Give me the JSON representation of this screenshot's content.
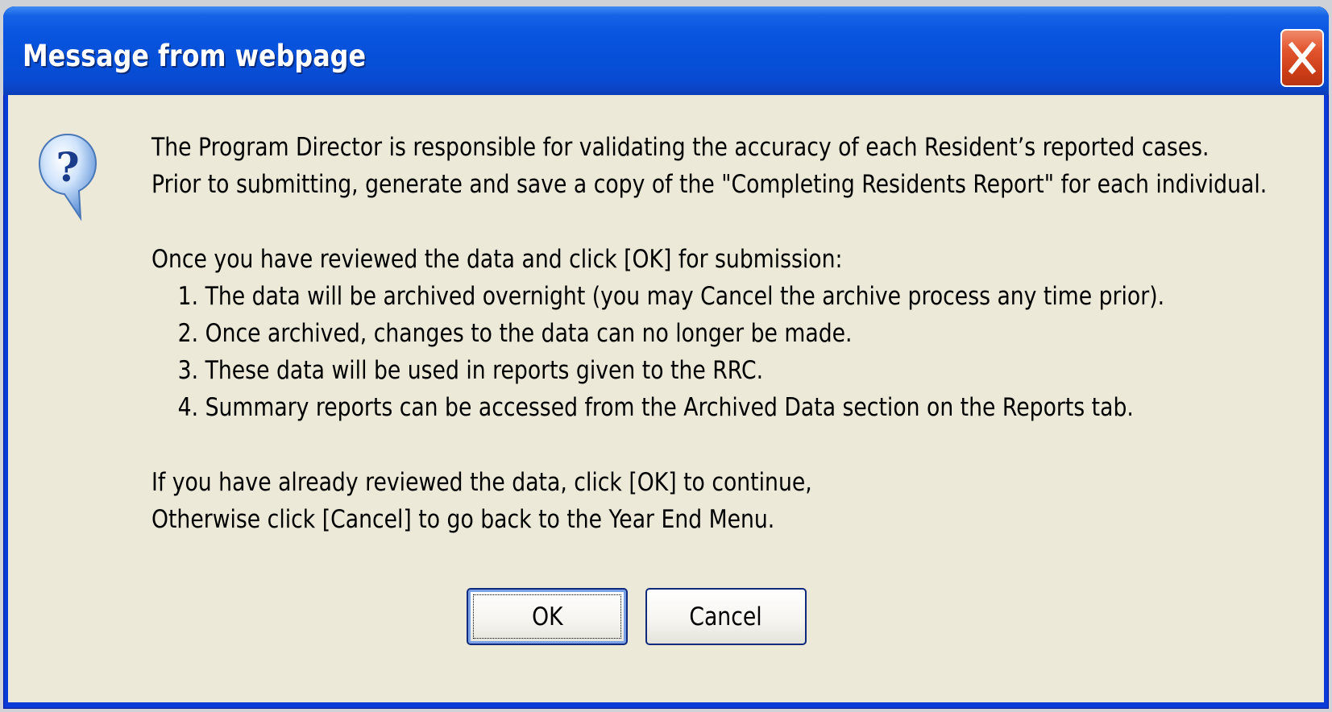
{
  "dialog": {
    "title": "Message from webpage",
    "icon": "question-icon",
    "close_icon": "close-icon",
    "message": {
      "intro_line1": "The Program Director is responsible for validating the accuracy of each Resident’s reported cases.",
      "intro_line2": "Prior to submitting, generate and save a copy of the \"Completing Residents Report\" for each individual.",
      "list_intro": "Once you have reviewed the data and click [OK] for submission:",
      "items": [
        "1. The data will be archived overnight (you may Cancel the archive process any time prior).",
        "2. Once archived, changes to the data can no longer be made.",
        "3. These data will be used in reports given to the RRC.",
        "4. Summary reports can be accessed from the Archived Data section on the Reports tab."
      ],
      "outro_line1": "If you have already reviewed the data, click [OK] to continue,",
      "outro_line2": "Otherwise click [Cancel] to go back to the Year End Menu."
    },
    "buttons": {
      "ok_label": "OK",
      "cancel_label": "Cancel"
    }
  },
  "colors": {
    "titlebar": "#0650d8",
    "client_background": "#ece9d8",
    "close_button": "#cc3d17"
  }
}
